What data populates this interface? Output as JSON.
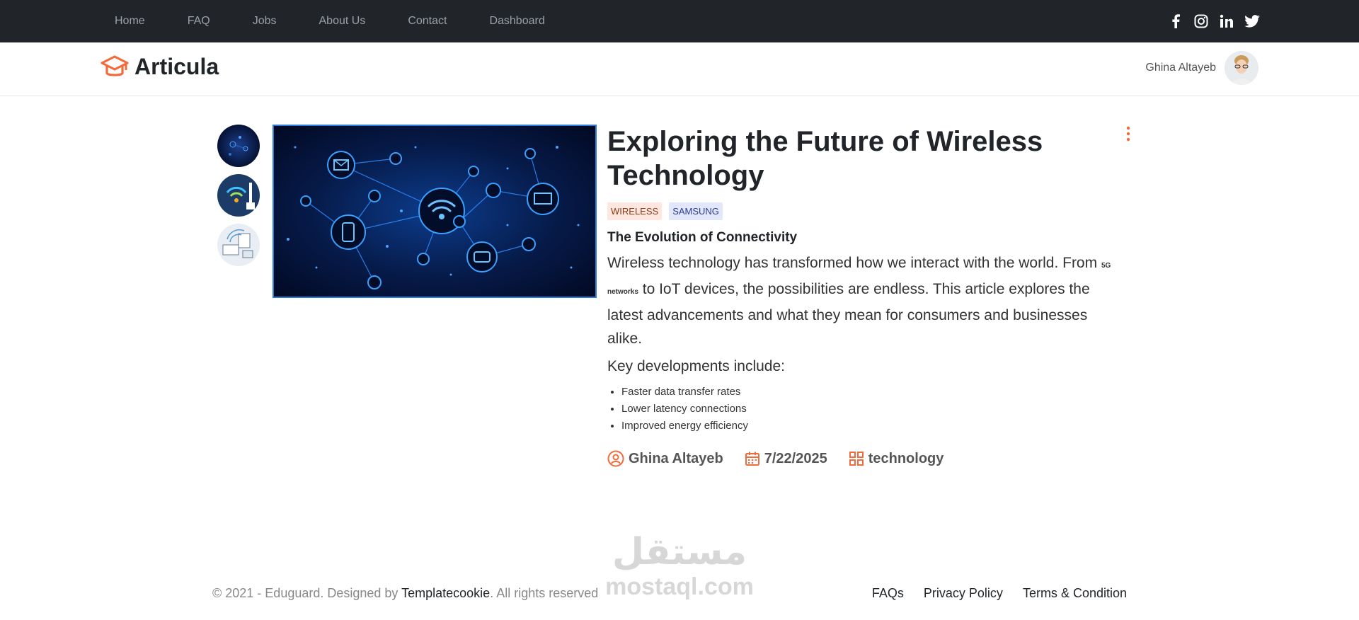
{
  "nav": {
    "items": [
      "Home",
      "FAQ",
      "Jobs",
      "About Us",
      "Contact",
      "Dashboard"
    ],
    "social_icons": [
      "facebook-icon",
      "instagram-icon",
      "linkedin-icon",
      "twitter-icon"
    ]
  },
  "header": {
    "brand": "Articula",
    "user_name": "Ghina Altayeb"
  },
  "article": {
    "title": "Exploring the Future of Wireless Technology",
    "tags": [
      "WIRELESS",
      "SAMSUNG"
    ],
    "subtitle": "The Evolution of Connectivity",
    "body_start": "Wireless technology has transformed how we interact with the world. From ",
    "body_small": "5G networks",
    "body_end": " to IoT devices, the possibilities are endless. This article explores the latest advancements and what they mean for consumers and businesses alike.",
    "key_heading": "Key developments include:",
    "list": [
      "Faster data transfer rates",
      "Lower latency connections",
      "Improved energy efficiency"
    ],
    "author": "Ghina Altayeb",
    "date": "7/22/2025",
    "category": "technology"
  },
  "footer": {
    "copyright_start": "© 2021 - Eduguard. Designed by ",
    "copyright_link": "Templatecookie",
    "copyright_end": ". All rights reserved",
    "links": [
      "FAQs",
      "Privacy Policy",
      "Terms & Condition"
    ]
  },
  "watermark": {
    "arabic": "مستقل",
    "latin": "mostaql.com"
  },
  "colors": {
    "accent": "#f26b3a",
    "topbar": "#212529"
  }
}
